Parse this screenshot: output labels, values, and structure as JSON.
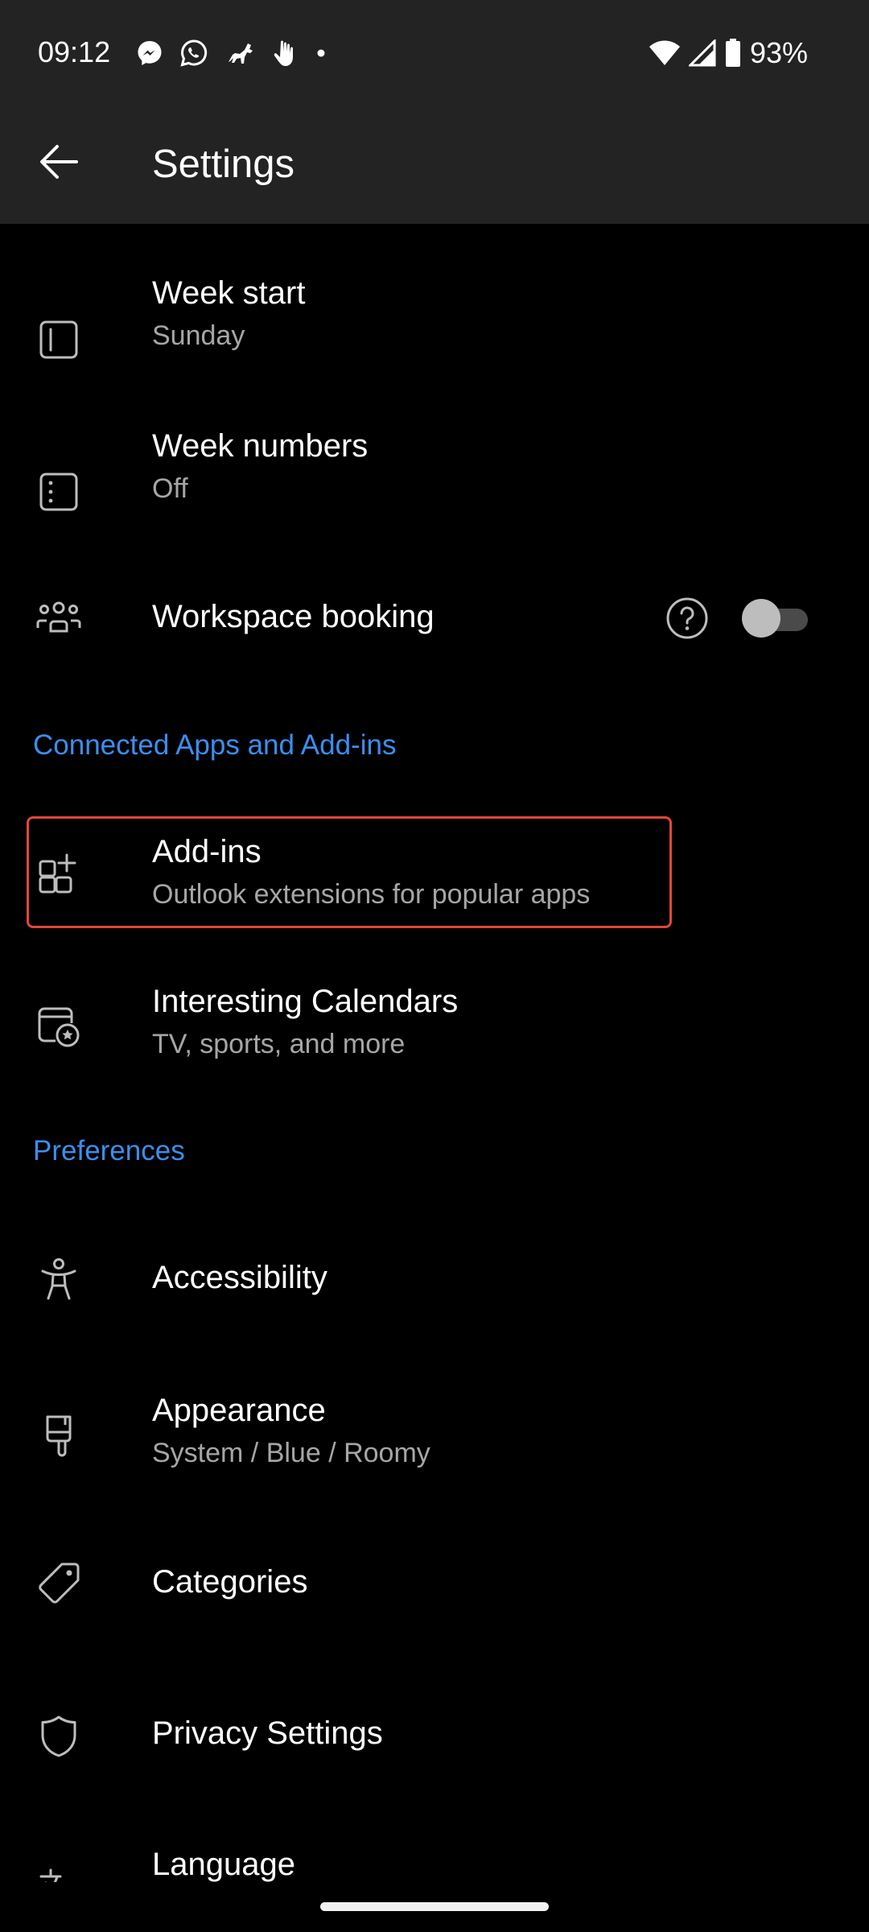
{
  "status_bar": {
    "time": "09:12",
    "notification_icons": [
      "messenger-icon",
      "whatsapp-icon",
      "horse-icon",
      "hand-icon",
      "dot-icon"
    ],
    "battery": "93%"
  },
  "app_bar": {
    "title": "Settings"
  },
  "calendar_section": {
    "items": [
      {
        "title": "Week start",
        "subtitle": "Sunday"
      },
      {
        "title": "Week numbers",
        "subtitle": "Off"
      },
      {
        "title": "Workspace booking",
        "toggle": "off"
      }
    ]
  },
  "connected_section": {
    "header": "Connected Apps and Add-ins",
    "items": [
      {
        "title": "Add-ins",
        "subtitle": "Outlook extensions for popular apps"
      },
      {
        "title": "Interesting Calendars",
        "subtitle": "TV, sports, and more"
      }
    ]
  },
  "preferences_section": {
    "header": "Preferences",
    "items": [
      {
        "title": "Accessibility"
      },
      {
        "title": "Appearance",
        "subtitle": "System / Blue / Roomy"
      },
      {
        "title": "Categories"
      },
      {
        "title": "Privacy Settings"
      },
      {
        "title": "Language"
      }
    ]
  },
  "colors": {
    "background": "#000000",
    "bar": "#232323",
    "accent": "#3b8ef0",
    "highlight": "#e0473a",
    "secondary_text": "#a6a6a6"
  }
}
